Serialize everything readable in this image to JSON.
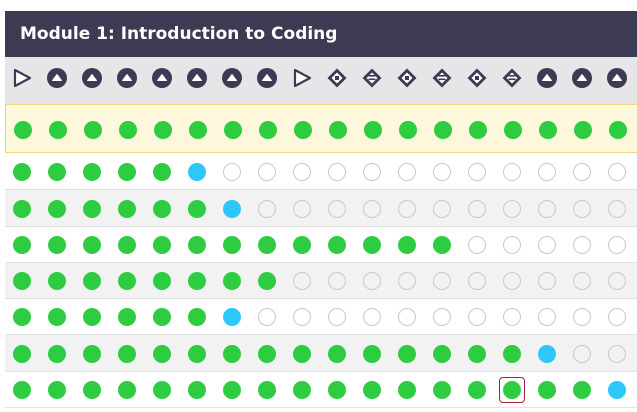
{
  "module": {
    "title": "Module 1: Introduction to Coding"
  },
  "colors": {
    "header_bg": "#3d3a54",
    "icon_strip_bg": "#e6e6e9",
    "complete": "#2ecc40",
    "current": "#2ec7fa",
    "incomplete": "#ffffff",
    "selection_outline": "#a0243b",
    "highlight_row_bg": "#fdf7dc"
  },
  "columns": [
    {
      "icon": "play-icon"
    },
    {
      "icon": "eject-icon"
    },
    {
      "icon": "eject-icon"
    },
    {
      "icon": "eject-icon"
    },
    {
      "icon": "eject-icon"
    },
    {
      "icon": "eject-icon"
    },
    {
      "icon": "eject-icon"
    },
    {
      "icon": "eject-icon"
    },
    {
      "icon": "play-icon"
    },
    {
      "icon": "diamond-dot-icon"
    },
    {
      "icon": "diamond-lines-icon"
    },
    {
      "icon": "diamond-dot-icon"
    },
    {
      "icon": "diamond-lines-icon"
    },
    {
      "icon": "diamond-dot-icon"
    },
    {
      "icon": "diamond-lines-icon"
    },
    {
      "icon": "eject-icon"
    },
    {
      "icon": "eject-icon"
    },
    {
      "icon": "eject-icon"
    }
  ],
  "rows": [
    {
      "highlight": true,
      "cells": [
        "c",
        "c",
        "c",
        "c",
        "c",
        "c",
        "c",
        "c",
        "c",
        "c",
        "c",
        "c",
        "c",
        "c",
        "c",
        "c",
        "c",
        "c"
      ]
    },
    {
      "highlight": false,
      "cells": [
        "c",
        "c",
        "c",
        "c",
        "c",
        "a",
        "e",
        "e",
        "e",
        "e",
        "e",
        "e",
        "e",
        "e",
        "e",
        "e",
        "e",
        "e"
      ]
    },
    {
      "highlight": false,
      "cells": [
        "c",
        "c",
        "c",
        "c",
        "c",
        "c",
        "a",
        "e",
        "e",
        "e",
        "e",
        "e",
        "e",
        "e",
        "e",
        "e",
        "e",
        "e"
      ]
    },
    {
      "highlight": false,
      "cells": [
        "c",
        "c",
        "c",
        "c",
        "c",
        "c",
        "c",
        "c",
        "c",
        "c",
        "c",
        "c",
        "c",
        "e",
        "e",
        "e",
        "e",
        "e"
      ]
    },
    {
      "highlight": false,
      "cells": [
        "c",
        "c",
        "c",
        "c",
        "c",
        "c",
        "c",
        "c",
        "e",
        "e",
        "e",
        "e",
        "e",
        "e",
        "e",
        "e",
        "e",
        "e"
      ]
    },
    {
      "highlight": false,
      "cells": [
        "c",
        "c",
        "c",
        "c",
        "c",
        "c",
        "a",
        "e",
        "e",
        "e",
        "e",
        "e",
        "e",
        "e",
        "e",
        "e",
        "e",
        "e"
      ]
    },
    {
      "highlight": false,
      "cells": [
        "c",
        "c",
        "c",
        "c",
        "c",
        "c",
        "c",
        "c",
        "c",
        "c",
        "c",
        "c",
        "c",
        "c",
        "c",
        "a",
        "e",
        "e"
      ]
    },
    {
      "highlight": false,
      "cells": [
        "c",
        "c",
        "c",
        "c",
        "c",
        "c",
        "c",
        "c",
        "c",
        "c",
        "c",
        "c",
        "c",
        "c",
        "c",
        "c",
        "c",
        "a"
      ]
    }
  ],
  "selected_cell": {
    "row": 7,
    "col": 14
  }
}
